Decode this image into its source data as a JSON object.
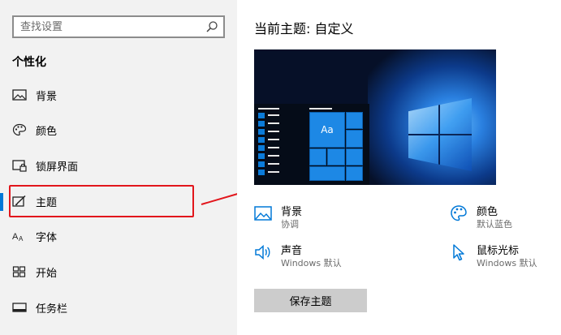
{
  "search": {
    "placeholder": "查找设置"
  },
  "sidebar": {
    "section_title": "个性化",
    "items": [
      {
        "label": "背景",
        "icon": "image-icon"
      },
      {
        "label": "颜色",
        "icon": "palette-icon"
      },
      {
        "label": "锁屏界面",
        "icon": "lock-screen-icon"
      },
      {
        "label": "主题",
        "icon": "theme-brush-icon",
        "active": true
      },
      {
        "label": "字体",
        "icon": "font-icon"
      },
      {
        "label": "开始",
        "icon": "start-grid-icon"
      },
      {
        "label": "任务栏",
        "icon": "taskbar-icon"
      }
    ]
  },
  "main": {
    "current_theme": "当前主题: 自定义",
    "preview": {
      "tile_label": "Aa"
    },
    "settings": {
      "background": {
        "title": "背景",
        "value": "协调",
        "icon": "image-icon"
      },
      "color": {
        "title": "颜色",
        "value": "默认蓝色",
        "icon": "palette-icon"
      },
      "sound": {
        "title": "声音",
        "value": "Windows 默认",
        "icon": "speaker-icon"
      },
      "cursor": {
        "title": "鼠标光标",
        "value": "Windows 默认",
        "icon": "cursor-icon"
      }
    },
    "save_label": "保存主题"
  },
  "colors": {
    "accent": "#0078d7",
    "highlight": "#e2161c",
    "sidebar_bg": "#f2f2f2"
  }
}
